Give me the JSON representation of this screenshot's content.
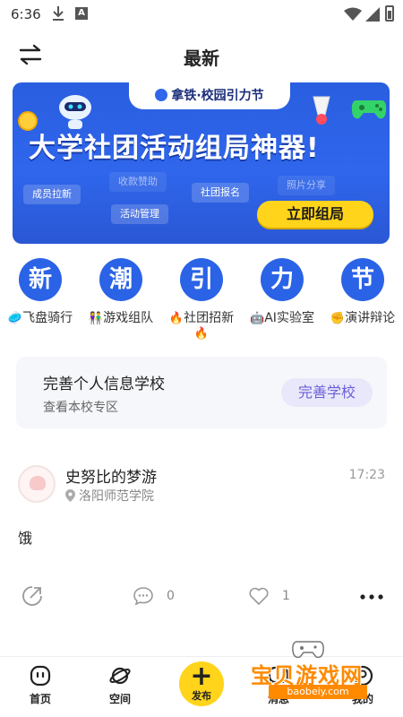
{
  "status": {
    "time": "6:36"
  },
  "header": {
    "title": "最新"
  },
  "banner": {
    "pill": "拿铁·校园引力节",
    "headline": "大学社团活动组局神器!",
    "tags": [
      "成员拉新",
      "收款赞助",
      "社团报名",
      "照片分享",
      "活动管理"
    ],
    "cta": "立即组局"
  },
  "categories": [
    {
      "icon_char": "新",
      "emoji": "🥏",
      "label": "飞盘骑行"
    },
    {
      "icon_char": "潮",
      "emoji": "👫",
      "label": "游戏组队"
    },
    {
      "icon_char": "引",
      "emoji": "🔥",
      "label": "社团招新",
      "trail": "🔥"
    },
    {
      "icon_char": "力",
      "emoji": "🤖",
      "label": "AI实验室"
    },
    {
      "icon_char": "节",
      "emoji": "✊",
      "label": "演讲辩论"
    }
  ],
  "profile_card": {
    "title": "完善个人信息学校",
    "subtitle": "查看本校专区",
    "button": "完善学校"
  },
  "post": {
    "user": "史努比的梦游",
    "school": "洛阳师范学院",
    "time": "17:23",
    "text": "饿",
    "comments": "0",
    "likes": "1"
  },
  "bottom_nav": {
    "home": "首页",
    "space": "空间",
    "publish": "发布",
    "message": "消息",
    "mine": "我的"
  },
  "watermark": {
    "text": "宝贝游戏网",
    "url": "baobeiy.com"
  },
  "colors": {
    "accent_blue": "#2b63e6",
    "accent_yellow": "#ffd41a",
    "button_purple": "#6b5fd6"
  }
}
